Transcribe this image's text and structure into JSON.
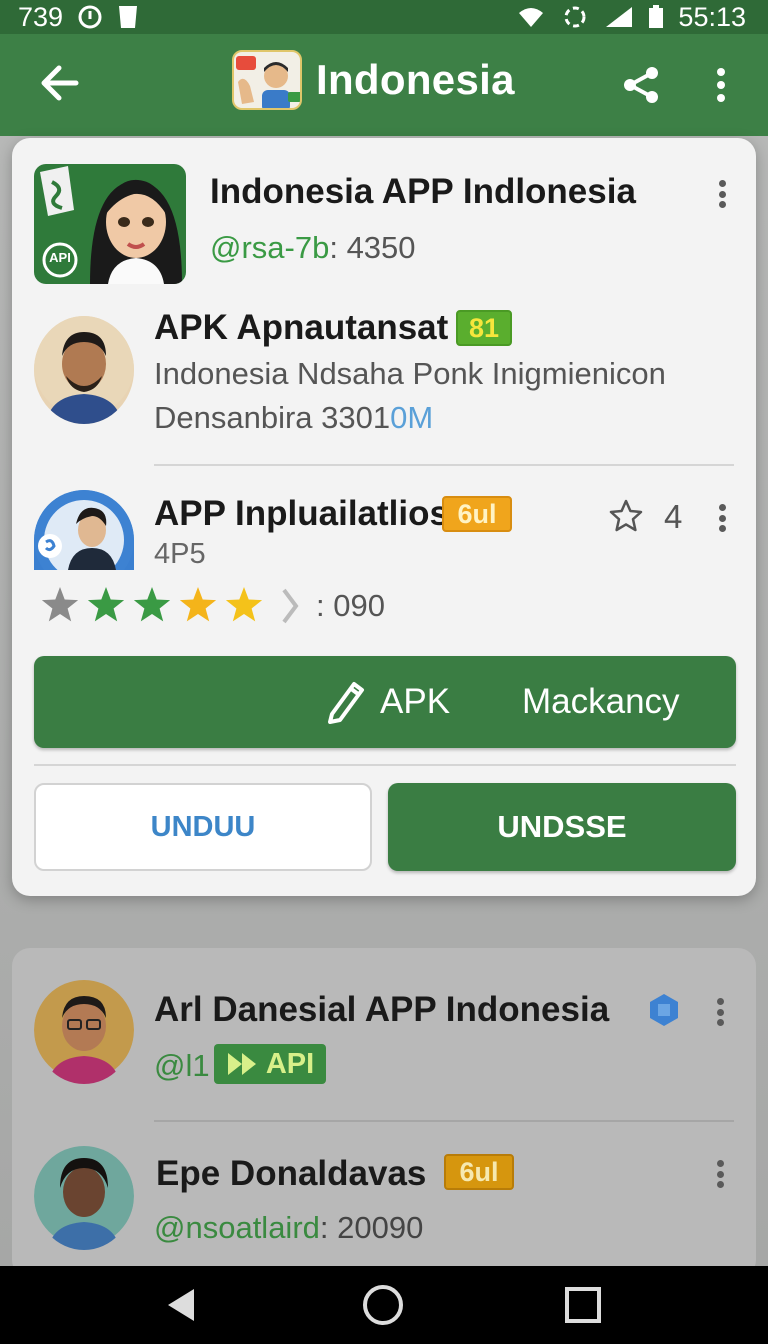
{
  "status_bar": {
    "time_left": "739",
    "time_right": "55:13"
  },
  "app_bar": {
    "title": "Indonesia"
  },
  "main_card": {
    "app": {
      "name": "Indonesia APP Indlonesia",
      "handle_prefix": "@rsa-7b",
      "handle_suffix": ": 4350",
      "icon_label": "API"
    },
    "item1": {
      "title": "APK Apnautansat",
      "badge": "81",
      "line1": "Indonesia Ndsaha Ponk Inigmienicon",
      "line2_prefix": "Densanbira 3301",
      "line2_suffix": "0M"
    },
    "item2": {
      "title": "APP Inpluailatlios",
      "badge": "6ul",
      "sub": "4P5",
      "star_count": "4",
      "rating_text": ": 090",
      "rating_stars": [
        {
          "color": "#8a8a8a"
        },
        {
          "color": "#3a9a44"
        },
        {
          "color": "#3a9a44"
        },
        {
          "color": "#f4b41a"
        },
        {
          "color": "#f4c21a"
        }
      ]
    },
    "primary_button": {
      "label1": "APK",
      "label2": "Mackancy"
    },
    "buttons": {
      "left": "UNDUU",
      "right": "UNDSSE"
    }
  },
  "card2": {
    "item1": {
      "title": "Arl Danesial APP Indonesia",
      "handle": "@l1",
      "badge": "API"
    },
    "item2": {
      "title": "Epe Donaldavas",
      "badge": "6ul",
      "handle_prefix": "@nsoatlaird",
      "handle_suffix": ": 20090"
    }
  },
  "colors": {
    "green_dark": "#2f6a37",
    "green": "#3a7d43",
    "badge_green": "#5aae2e",
    "badge_orange": "#f0a51c",
    "link_blue": "#3d86c8"
  }
}
